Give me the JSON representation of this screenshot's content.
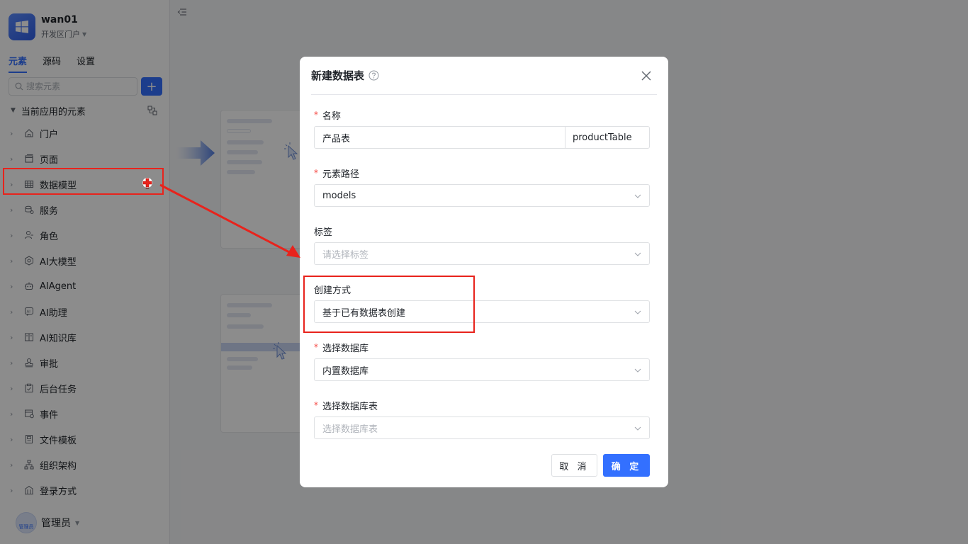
{
  "app": {
    "name": "wan01",
    "env": "开发区门户"
  },
  "tabs": [
    {
      "label": "元素",
      "active": true
    },
    {
      "label": "源码",
      "active": false
    },
    {
      "label": "设置",
      "active": false
    }
  ],
  "search": {
    "placeholder": "搜索元素"
  },
  "tree": {
    "title": "当前应用的元素",
    "items": [
      {
        "label": "门户",
        "icon": "home-icon"
      },
      {
        "label": "页面",
        "icon": "page-icon"
      },
      {
        "label": "数据模型",
        "icon": "table-icon",
        "highlighted": true
      },
      {
        "label": "服务",
        "icon": "service-icon"
      },
      {
        "label": "角色",
        "icon": "role-icon"
      },
      {
        "label": "AI大模型",
        "icon": "ai-model-icon"
      },
      {
        "label": "AIAgent",
        "icon": "robot-icon"
      },
      {
        "label": "AI助理",
        "icon": "ai-assistant-icon"
      },
      {
        "label": "AI知识库",
        "icon": "book-icon"
      },
      {
        "label": "审批",
        "icon": "approval-icon"
      },
      {
        "label": "后台任务",
        "icon": "task-icon"
      },
      {
        "label": "事件",
        "icon": "event-icon"
      },
      {
        "label": "文件模板",
        "icon": "file-template-icon"
      },
      {
        "label": "组织架构",
        "icon": "org-icon"
      },
      {
        "label": "登录方式",
        "icon": "login-icon"
      }
    ]
  },
  "user": {
    "name": "管理员",
    "avatar_text": "管理员"
  },
  "modal": {
    "title": "新建数据表",
    "name": {
      "label": "名称",
      "value": "产品表",
      "code": "productTable"
    },
    "path": {
      "label": "元素路径",
      "value": "models"
    },
    "tags": {
      "label": "标签",
      "placeholder": "请选择标签"
    },
    "create_mode": {
      "label": "创建方式",
      "value": "基于已有数据表创建"
    },
    "database": {
      "label": "选择数据库",
      "value": "内置数据库"
    },
    "db_table": {
      "label": "选择数据库表",
      "placeholder": "选择数据库表"
    },
    "cancel_label": "取 消",
    "ok_label": "确 定"
  },
  "colors": {
    "accent": "#3370ff",
    "annotation": "#e8231c",
    "required": "#f54a45"
  }
}
